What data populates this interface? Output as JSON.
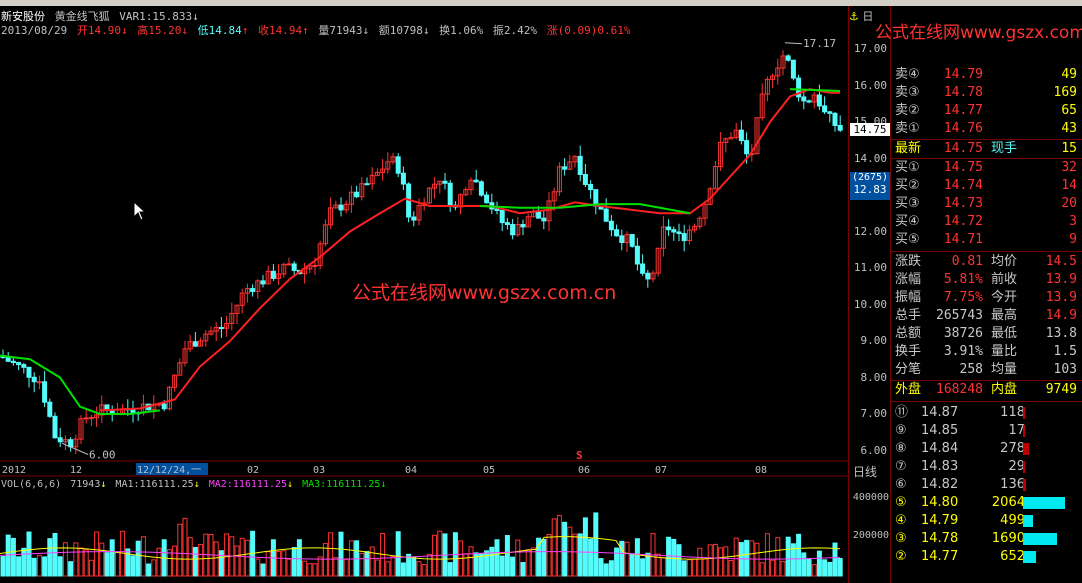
{
  "stock": {
    "name": "新安股份",
    "indicator": "黄金线飞狐",
    "var_label": "VAR1:15.833",
    "var_arrow": "↓"
  },
  "quote_line": {
    "date": "2013/08/29",
    "open": "开14.90",
    "open_arrow": "↓",
    "high": "高15.20",
    "high_arrow": "↓",
    "low": "低14.84",
    "low_arrow": "↑",
    "close": "收14.94",
    "close_arrow": "↑",
    "volume": "量71943",
    "volume_arrow": "↓",
    "amount": "额10798",
    "amount_arrow": "↓",
    "turnover": "换1.06%",
    "amplitude": "振2.42%",
    "change": "涨(0.09)0.61%"
  },
  "vol_header": {
    "label": "VOL(6,6,6)",
    "value": "71943",
    "value_arrow": "↓",
    "ma1": "MA1:116111.25",
    "ma1_arrow": "↓",
    "ma2": "MA2:116111.25",
    "ma2_arrow": "↓",
    "ma3": "MA3:116111.25",
    "ma3_arrow": "↓"
  },
  "price_axis": [
    "17.00",
    "16.00",
    "15.00",
    "14.00",
    "13.00",
    "12.00",
    "11.00",
    "10.00",
    "9.00",
    "8.00",
    "7.00",
    "6.00"
  ],
  "vol_axis": [
    "400000",
    "200000"
  ],
  "current_price_tag": "14.75",
  "cursor_tag": {
    "top": "(2675)",
    "value": "12.83"
  },
  "axis_corner": "日",
  "period_label": "日线",
  "chart_annotations": {
    "high": "17.17",
    "low": "6.00",
    "signal": "S"
  },
  "time_labels": [
    "2012",
    "12",
    "12/12/24,一",
    "02",
    "03",
    "04",
    "05",
    "06",
    "07",
    "08"
  ],
  "watermark": {
    "top": "公式在线网www.gszx.com.cn",
    "center": "公式在线网www.gszx.com.cn"
  },
  "order_book": {
    "sells": [
      {
        "label": "卖④",
        "price": "14.79",
        "vol": "49"
      },
      {
        "label": "卖③",
        "price": "14.78",
        "vol": "169"
      },
      {
        "label": "卖②",
        "price": "14.77",
        "vol": "65"
      },
      {
        "label": "卖①",
        "price": "14.76",
        "vol": "43"
      }
    ],
    "latest": {
      "label": "最新",
      "price": "14.75",
      "label2": "现手",
      "vol": "15"
    },
    "buys": [
      {
        "label": "买①",
        "price": "14.75",
        "vol": "32"
      },
      {
        "label": "买②",
        "price": "14.74",
        "vol": "14"
      },
      {
        "label": "买③",
        "price": "14.73",
        "vol": "20"
      },
      {
        "label": "买④",
        "price": "14.72",
        "vol": "3"
      },
      {
        "label": "买⑤",
        "price": "14.71",
        "vol": "9"
      }
    ]
  },
  "stats": [
    {
      "l1": "涨跌",
      "v1": "0.81",
      "l2": "均价",
      "v2": "14.5"
    },
    {
      "l1": "涨幅",
      "v1": "5.81%",
      "l2": "前收",
      "v2": "13.9"
    },
    {
      "l1": "振幅",
      "v1": "7.75%",
      "l2": "今开",
      "v2": "13.9"
    },
    {
      "l1": "总手",
      "v1": "265743",
      "l2": "最高",
      "v2": "14.9"
    },
    {
      "l1": "总额",
      "v1": "38726",
      "l2": "最低",
      "v2": "13.8"
    },
    {
      "l1": "换手",
      "v1": "3.91%",
      "l2": "量比",
      "v2": "1.5"
    },
    {
      "l1": "分笔",
      "v1": "258",
      "l2": "均量",
      "v2": "103"
    }
  ],
  "outer_inner": {
    "l1": "外盘",
    "v1": "168248",
    "l2": "内盘",
    "v2": "9749"
  },
  "price_levels": [
    {
      "idx": "⑪",
      "price": "14.87",
      "vol": "118"
    },
    {
      "idx": "⑨",
      "price": "14.85",
      "vol": "17"
    },
    {
      "idx": "⑧",
      "price": "14.84",
      "vol": "278"
    },
    {
      "idx": "⑦",
      "price": "14.83",
      "vol": "29"
    },
    {
      "idx": "⑥",
      "price": "14.82",
      "vol": "136"
    },
    {
      "idx": "⑤",
      "price": "14.80",
      "vol": "2064"
    },
    {
      "idx": "④",
      "price": "14.79",
      "vol": "499"
    },
    {
      "idx": "③",
      "price": "14.78",
      "vol": "1690"
    },
    {
      "idx": "②",
      "price": "14.77",
      "vol": "652"
    }
  ],
  "colors": {
    "up": "#ff3232",
    "down": "#54fcfc",
    "ma_red": "#ff2020",
    "ma_green": "#00e000",
    "yellow": "#ffff00",
    "vol_ma2": "#ff40ff"
  }
}
